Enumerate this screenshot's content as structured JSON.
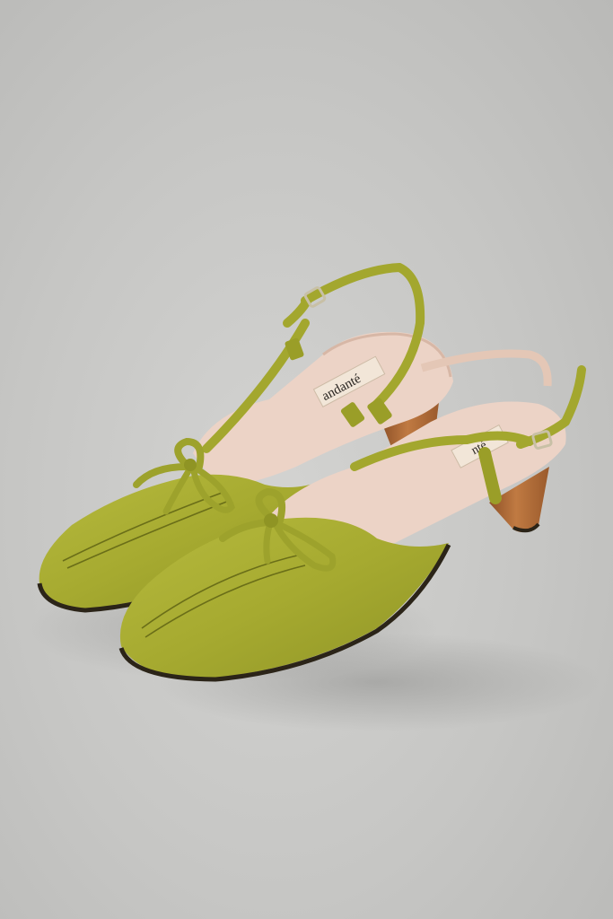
{
  "photo": {
    "subject": "pair-of-slingback-heels",
    "colors": {
      "background": "#c6c6c4",
      "leather": "#a8ac32",
      "leather_shadow": "#7f8420",
      "lining": "#ecd3c6",
      "heel_wood": "#b06a36",
      "sole_edge": "#2b2418",
      "buckle": "#c8c0a6"
    }
  },
  "brand": {
    "left_insole_label": "andanté",
    "right_insole_label": "nté"
  }
}
